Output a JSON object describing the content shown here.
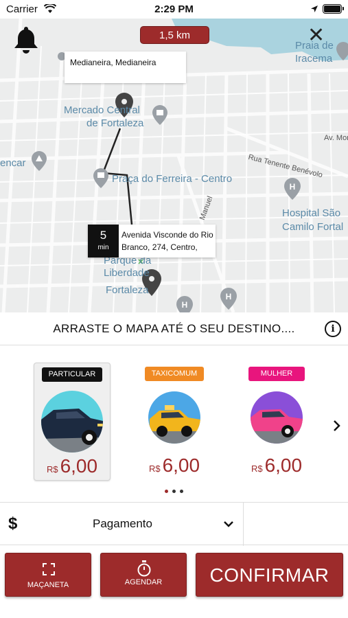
{
  "status_bar": {
    "carrier": "Carrier",
    "time": "2:29 PM"
  },
  "map": {
    "distance": "1,5 km",
    "origin_address": "Medianeira, Medianeira",
    "eta_value": "5",
    "eta_unit": "min",
    "destination_address": "Avenida Visconde do Rio Branco, 274, Centro,",
    "labels": {
      "mercado": "Mercado Central",
      "fortaleza": "de Fortaleza",
      "praca": "Praça do Ferreira - Centro",
      "parque1": "Parque da",
      "parque2": "Liberdade",
      "parque3": "Fortaleza",
      "hospital1": "Hospital São",
      "hospital2": "Camilo Fortal",
      "praia1": "Praia de",
      "praia2": "Iracema",
      "encar": "encar",
      "rua_tenente": "Rua Tenente Benévolo",
      "av_mon": "Av. Mon",
      "manuel": "Manuel"
    }
  },
  "instruction": "ARRASTE O MAPA ATÉ O SEU DESTINO....",
  "vehicles": [
    {
      "tag": "PARTICULAR",
      "tag_color": "#111111",
      "currency": "R$",
      "price": "6,00"
    },
    {
      "tag": "TAXICOMUM",
      "tag_color": "#f08a24",
      "currency": "R$",
      "price": "6,00"
    },
    {
      "tag": "MULHER",
      "tag_color": "#e8157d",
      "currency": "R$",
      "price": "6,00"
    }
  ],
  "payment": {
    "symbol": "$",
    "label": "Pagamento"
  },
  "buttons": {
    "macaneta": "MAÇANETA",
    "agendar": "AGENDAR",
    "confirmar": "CONFIRMAR"
  },
  "colors": {
    "accent": "#9d2b2b"
  }
}
